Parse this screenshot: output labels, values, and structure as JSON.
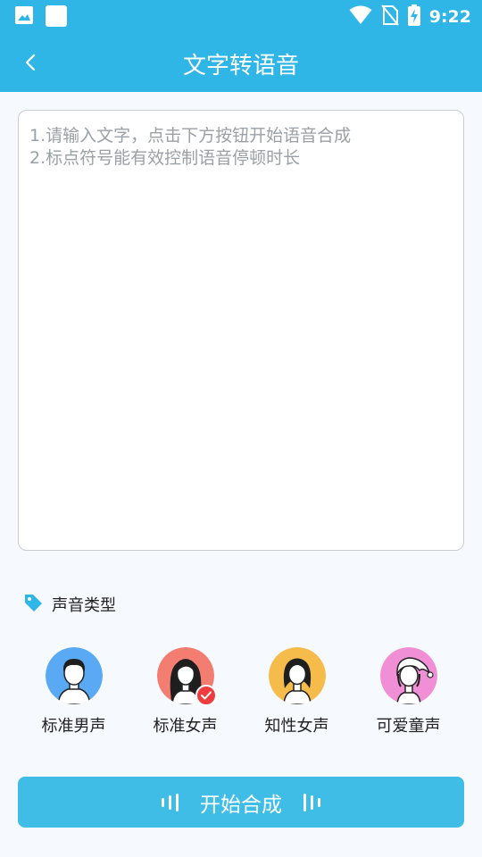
{
  "status_bar": {
    "time": "9:22"
  },
  "header": {
    "title": "文字转语音"
  },
  "input": {
    "placeholder": "1.请输入文字，点击下方按钮开始语音合成\n2.标点符号能有效控制语音停顿时长",
    "value": ""
  },
  "voice_section": {
    "title": "声音类型",
    "selected": "标准女声",
    "voices": [
      {
        "label": "标准男声",
        "bg": "#5aa9f5"
      },
      {
        "label": "标准女声",
        "bg": "#f47d72"
      },
      {
        "label": "知性女声",
        "bg": "#f5bb4b"
      },
      {
        "label": "可爱童声",
        "bg": "#f08fd6"
      }
    ]
  },
  "actions": {
    "start_label": "开始合成"
  },
  "colors": {
    "primary": "#2fb5e6",
    "button": "#40bde6",
    "check": "#ef3d3d"
  }
}
